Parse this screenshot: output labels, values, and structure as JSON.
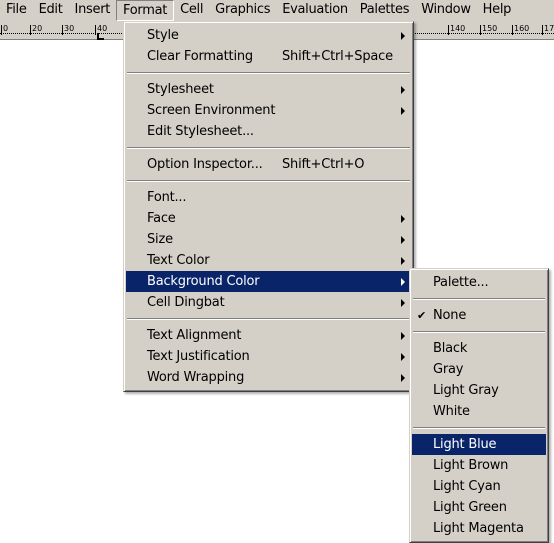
{
  "menubar": [
    "File",
    "Edit",
    "Insert",
    "Format",
    "Cell",
    "Graphics",
    "Evaluation",
    "Palettes",
    "Window",
    "Help"
  ],
  "ruler": [
    "0",
    "20",
    "30",
    "40",
    "140",
    "150",
    "160",
    "170"
  ],
  "format_menu": {
    "groups": [
      [
        {
          "label": "Style",
          "submenu": true
        },
        {
          "label": "Clear Formatting",
          "shortcut": "Shift+Ctrl+Space"
        }
      ],
      [
        {
          "label": "Stylesheet",
          "submenu": true
        },
        {
          "label": "Screen Environment",
          "submenu": true
        },
        {
          "label": "Edit Stylesheet..."
        }
      ],
      [
        {
          "label": "Option Inspector...",
          "shortcut": "Shift+Ctrl+O"
        }
      ],
      [
        {
          "label": "Font..."
        },
        {
          "label": "Face",
          "submenu": true
        },
        {
          "label": "Size",
          "submenu": true
        },
        {
          "label": "Text Color",
          "submenu": true
        },
        {
          "label": "Background Color",
          "submenu": true,
          "selected": true
        },
        {
          "label": "Cell Dingbat",
          "submenu": true
        }
      ],
      [
        {
          "label": "Text Alignment",
          "submenu": true
        },
        {
          "label": "Text Justification",
          "submenu": true
        },
        {
          "label": "Word Wrapping",
          "submenu": true
        }
      ]
    ]
  },
  "background_color_submenu": {
    "groups": [
      [
        {
          "label": "Palette..."
        }
      ],
      [
        {
          "label": "None",
          "checked": true
        }
      ],
      [
        {
          "label": "Black"
        },
        {
          "label": "Gray"
        },
        {
          "label": "Light Gray"
        },
        {
          "label": "White"
        }
      ],
      [
        {
          "label": "Light Blue",
          "selected": true
        },
        {
          "label": "Light Brown"
        },
        {
          "label": "Light Cyan"
        },
        {
          "label": "Light Green"
        },
        {
          "label": "Light Magenta"
        }
      ]
    ]
  },
  "colors": {
    "menu_bg": "#d4d0c8",
    "highlight": "#0a246a"
  }
}
